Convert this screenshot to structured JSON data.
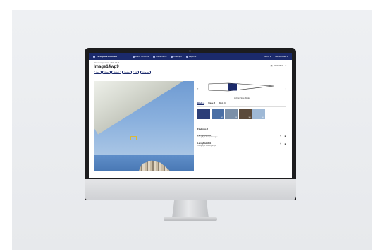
{
  "nav": {
    "brand": "Perceptual Robotics",
    "items": [
      "Wind Turbines",
      "Inspections",
      "Findings",
      "Reports"
    ],
    "right_items": [
      "Demo",
      "Demo User"
    ]
  },
  "page": {
    "breadcrumb": "Back to inspection · 2019-08-01",
    "title": "Image14wp9",
    "date": "2019-08-01",
    "tags": [
      "Lorry",
      "Rotor",
      "Blade 1",
      "Suction",
      "1/4",
      "0.0 m root"
    ]
  },
  "blade": {
    "label": "A-Front Side Blade",
    "prev_icon": "chevron-left-icon",
    "next_icon": "chevron-right-icon"
  },
  "tabs": [
    "Blade A",
    "Blade B",
    "Blade C"
  ],
  "active_tab": 0,
  "thumbnails": [
    {
      "label": "",
      "color": "#2c3e78"
    },
    {
      "label": "1/4",
      "color": "#4a6fa5"
    },
    {
      "label": "2/4",
      "color": "#7a8fa8"
    },
    {
      "label": "3/4",
      "color": "#5b4a3a"
    },
    {
      "label": "4/4",
      "color": "#9fb9d6"
    }
  ],
  "findings": {
    "heading": "Findings",
    "count": "2",
    "items": [
      {
        "name": "LeroiyRuki234",
        "sub": "Category 3 Ramp Damages"
      },
      {
        "name": "LeroiyRuki231",
        "sub": "Category 4 Leading Edge"
      }
    ]
  },
  "colors": {
    "nav": "#1b2a6b",
    "accent": "#1b2a6b"
  }
}
